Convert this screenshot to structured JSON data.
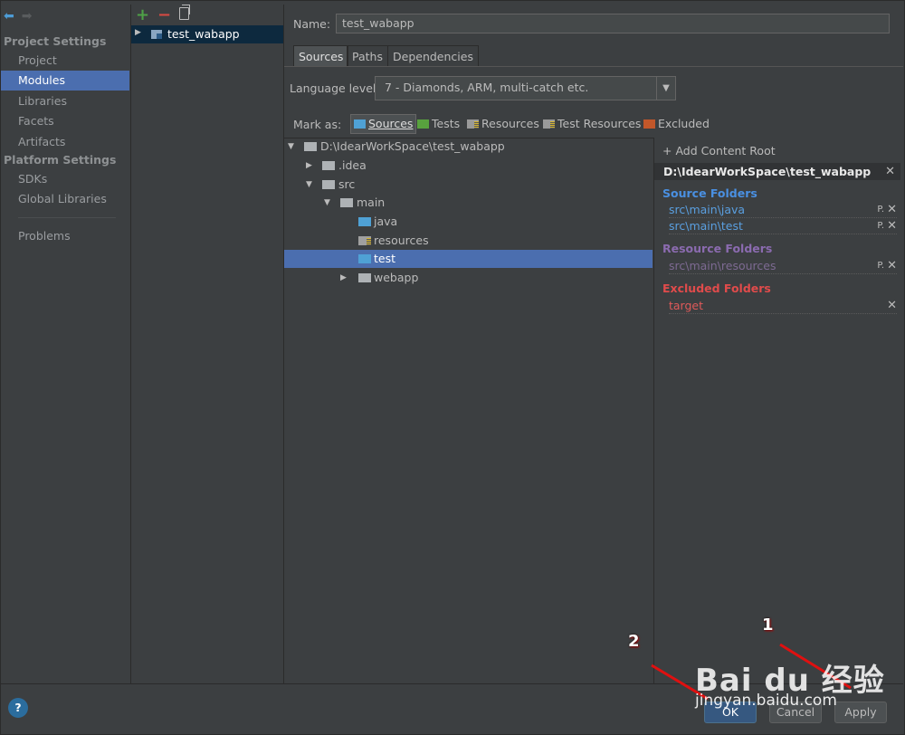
{
  "nav": {
    "groups": [
      {
        "title": "Project Settings",
        "items": [
          "Project",
          "Modules",
          "Libraries",
          "Facets",
          "Artifacts"
        ]
      },
      {
        "title": "Platform Settings",
        "items": [
          "SDKs",
          "Global Libraries"
        ]
      }
    ],
    "problems": "Problems",
    "selected": "Modules"
  },
  "modules": {
    "toolbar": {
      "add": "+",
      "remove": "−"
    },
    "items": [
      "test_wabapp"
    ]
  },
  "main": {
    "name_label": "Name:",
    "name_value": "test_wabapp",
    "tabs": [
      "Sources",
      "Paths",
      "Dependencies"
    ],
    "selected_tab": "Sources",
    "language_label": "Language level:",
    "language_value": "7 - Diamonds, ARM, multi-catch etc.",
    "mark_as_label": "Mark as:",
    "mark_as": [
      "Sources",
      "Tests",
      "Resources",
      "Test Resources",
      "Excluded"
    ]
  },
  "tree": {
    "rows": [
      {
        "label": "D:\\IdearWorkSpace\\test_wabapp",
        "expanded": true
      },
      {
        "label": ".idea",
        "expanded": false
      },
      {
        "label": "src",
        "expanded": true
      },
      {
        "label": "main",
        "expanded": true
      },
      {
        "label": "java"
      },
      {
        "label": "resources"
      },
      {
        "label": "test",
        "selected": true
      },
      {
        "label": "webapp",
        "expanded": false
      }
    ]
  },
  "content_root": {
    "add_label": "+ Add Content Root",
    "path": "D:\\IdearWorkSpace\\test_wabapp",
    "source_title": "Source Folders",
    "sources": [
      "src\\main\\java",
      "src\\main\\test"
    ],
    "resource_title": "Resource Folders",
    "resources": [
      "src\\main\\resources"
    ],
    "excluded_title": "Excluded Folders",
    "excluded": [
      "target"
    ]
  },
  "buttons": {
    "help": "?",
    "ok": "OK",
    "cancel": "Cancel",
    "apply": "Apply"
  },
  "annotations": {
    "label1": "1",
    "label2": "2"
  },
  "watermark": {
    "logo": "Bai du 经验",
    "url": "jingyan.baidu.com"
  }
}
